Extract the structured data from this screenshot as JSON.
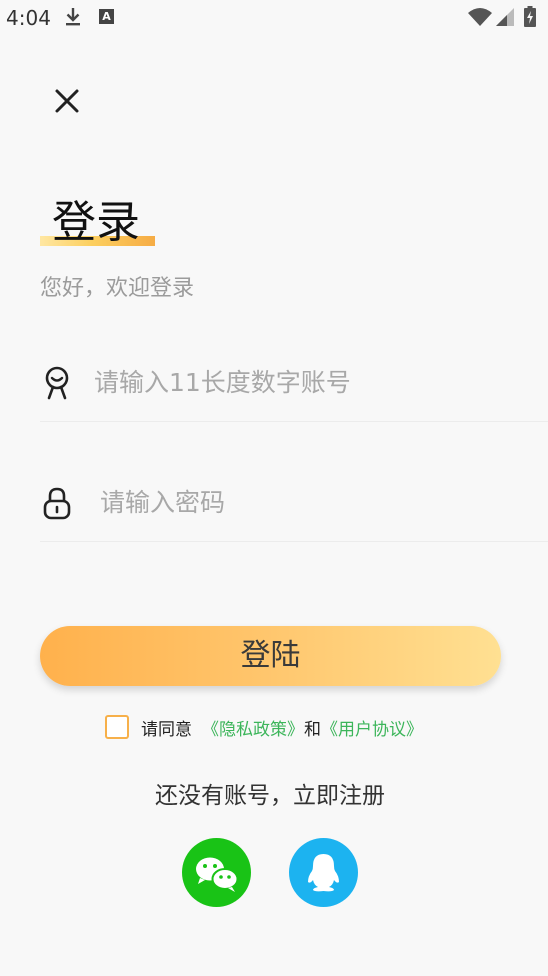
{
  "status_bar": {
    "time": "4:04",
    "icons": [
      "download-icon",
      "a-notification-icon",
      "wifi-icon",
      "cell-signal-icon",
      "battery-charging-icon"
    ],
    "a_letter": "A"
  },
  "header": {
    "close_icon": "close-icon"
  },
  "login": {
    "title": "登录",
    "welcome": "您好，欢迎登录",
    "account": {
      "icon": "user-icon",
      "placeholder": "请输入11长度数字账号",
      "value": ""
    },
    "password": {
      "icon": "lock-icon",
      "placeholder": "请输入密码",
      "value": ""
    },
    "submit_label": "登陆",
    "agreement": {
      "checked": false,
      "prefix": "请同意",
      "privacy_link": "《隐私政策》",
      "conjunction": "和",
      "user_link": "《用户协议》"
    },
    "register_label": "还没有账号，立即注册",
    "social": [
      {
        "name": "wechat-icon",
        "color": "#19c316"
      },
      {
        "name": "qq-icon",
        "color": "#1cb3f0"
      }
    ]
  },
  "colors": {
    "accent_gradient": [
      "#ffb14c",
      "#ffe092"
    ],
    "link_green": "#3cb55a",
    "checkbox_border": "#f7b04a"
  }
}
